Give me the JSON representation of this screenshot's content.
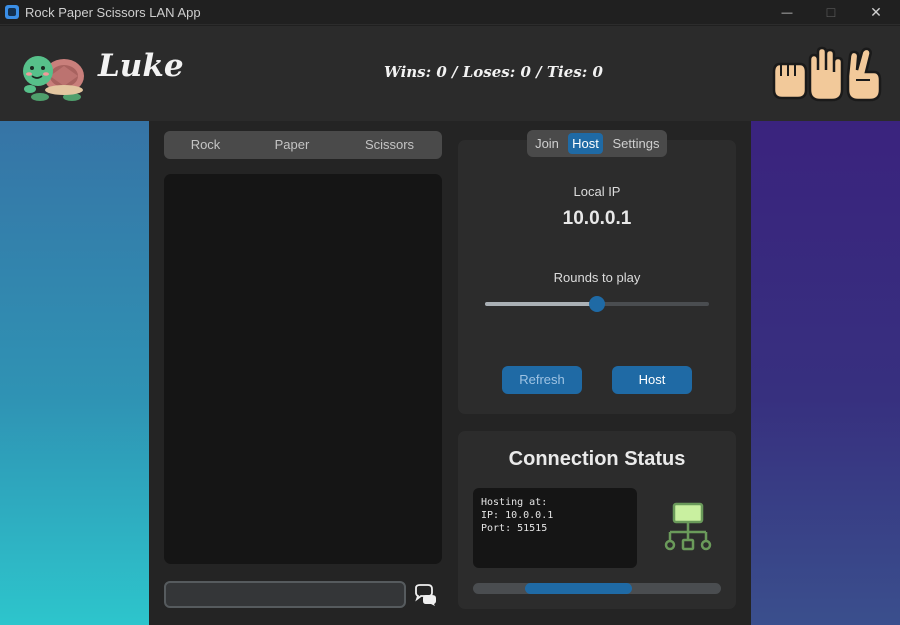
{
  "window": {
    "title": "Rock Paper Scissors LAN App",
    "controls": {
      "minimize": "—",
      "maximize": "☐",
      "close": "✕"
    }
  },
  "header": {
    "username": "Luke",
    "score_text": "Wins: 0 / Loses: 0 / Ties: 0",
    "avatar_icon": "turtle-icon",
    "hand_icons": [
      "rock-hand-icon",
      "paper-hand-icon",
      "scissors-hand-icon"
    ]
  },
  "game": {
    "choices": [
      "Rock",
      "Paper",
      "Scissors"
    ],
    "chat_input": {
      "value": "",
      "placeholder": ""
    },
    "send_icon": "chat-bubbles-icon"
  },
  "host_panel": {
    "tabs": [
      "Join",
      "Host",
      "Settings"
    ],
    "active_tab": "Host",
    "local_ip_label": "Local IP",
    "local_ip": "10.0.0.1",
    "rounds_label": "Rounds to play",
    "rounds_fraction": 0.5,
    "refresh_label": "Refresh",
    "host_label": "Host"
  },
  "connection": {
    "title": "Connection Status",
    "lines": [
      "Hosting at:",
      "IP: 10.0.0.1",
      "Port: 51515"
    ],
    "network_icon": "network-icon",
    "progress_start": 0.21,
    "progress_end": 0.64
  },
  "colors": {
    "accent": "#1f6aa5",
    "left_gradient": [
      "#3674a6",
      "#2dc5cc"
    ],
    "right_gradient": [
      "#3a237e",
      "#3a4f8d"
    ],
    "network_icon": "#7fa66e"
  }
}
